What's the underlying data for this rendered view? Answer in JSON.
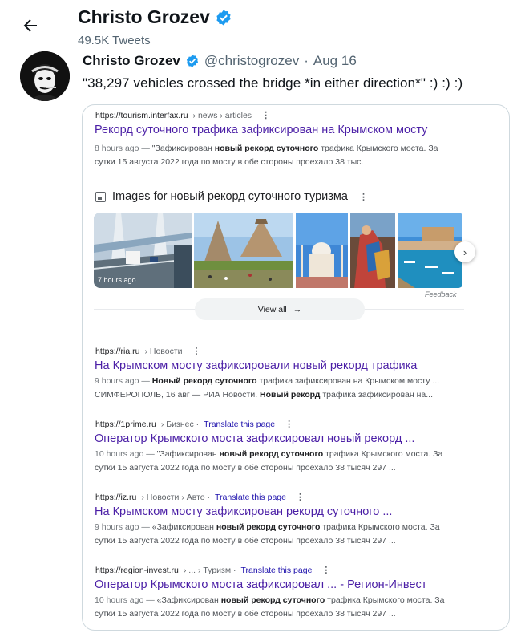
{
  "header": {
    "name": "Christo Grozev",
    "tweet_count": "49.5K Tweets"
  },
  "tweet": {
    "name": "Christo Grozev",
    "handle": "@christogrozev",
    "separator": "·",
    "date": "Aug 16",
    "text": "\"38,297 vehicles crossed the bridge *in either direction*\" :) :) :)"
  },
  "colors": {
    "verified": "#1d9bf0",
    "link_title": "#4b1fa6",
    "translate_link": "#1a0dab"
  },
  "icons": {
    "back": "arrow-left",
    "verified": "verified-badge",
    "images_section": "image-icon",
    "more": "vertical-ellipsis",
    "next": "chevron-right"
  },
  "search": {
    "result1": {
      "url": "https://tourism.interfax.ru",
      "crumb": "› news › articles",
      "title": "Рекорд суточного трафика зафиксирован на Крымском мосту",
      "line1": {
        "ago": "8 hours ago — ",
        "p1": "\"Зафиксирован ",
        "b1": "новый рекорд суточного",
        "p2": " трафика Крымского моста. За"
      },
      "line2": "сутки 15 августа 2022 года по мосту в обе стороны проехало 38 тыс."
    },
    "images": {
      "title": "Images for новый рекорд суточного туризма",
      "thumb1_caption": "7 hours ago",
      "view_all": "View all",
      "feedback": "Feedback"
    },
    "result2": {
      "url": "https://ria.ru",
      "crumb": "› Новости",
      "title": "На Крымском мосту зафиксировали новый рекорд трафика",
      "line1": {
        "ago": "9 hours ago — ",
        "b1": "Новый рекорд суточного",
        "p1": " трафика зафиксирован на Крымском мосту ..."
      },
      "line2": {
        "p1": "СИМФЕРОПОЛЬ, 16 авг — РИА Новости. ",
        "b1": "Новый рекорд",
        "p2": " трафика зафиксирован на..."
      }
    },
    "result3": {
      "url": "https://1prime.ru",
      "crumb": "› Бизнес ·",
      "translate": "Translate this page",
      "title": "Оператор Крымского моста зафиксировал новый рекорд ...",
      "line1": {
        "ago": "10 hours ago — ",
        "p1": "\"Зафиксирован ",
        "b1": "новый рекорд суточного",
        "p2": " трафика Крымского моста. За"
      },
      "line2": "сутки 15 августа 2022 года по мосту в обе стороны проехало 38 тысяч 297 ..."
    },
    "result4": {
      "url": "https://iz.ru",
      "crumb": "› Новости › Авто ·",
      "translate": "Translate this page",
      "title": "На Крымском мосту зафиксирован рекорд суточного ...",
      "line1": {
        "ago": "9 hours ago — ",
        "p1": "«Зафиксирован ",
        "b1": "новый рекорд суточного",
        "p2": " трафика Крымского моста. За"
      },
      "line2": "сутки 15 августа 2022 года по мосту в обе стороны проехало 38 тысяч 297 ..."
    },
    "result5": {
      "url": "https://region-invest.ru",
      "crumb": "› ... › Туризм ·",
      "translate": "Translate this page",
      "title": "Оператор Крымского моста зафиксировал ... - Регион-Инвест",
      "line1": {
        "ago": "10 hours ago — ",
        "p1": "«Зафиксирован ",
        "b1": "новый рекорд суточного",
        "p2": " трафика Крымского моста. За"
      },
      "line2": "сутки 15 августа 2022 года по мосту в обе стороны проехало 38 тысяч 297 ..."
    }
  }
}
